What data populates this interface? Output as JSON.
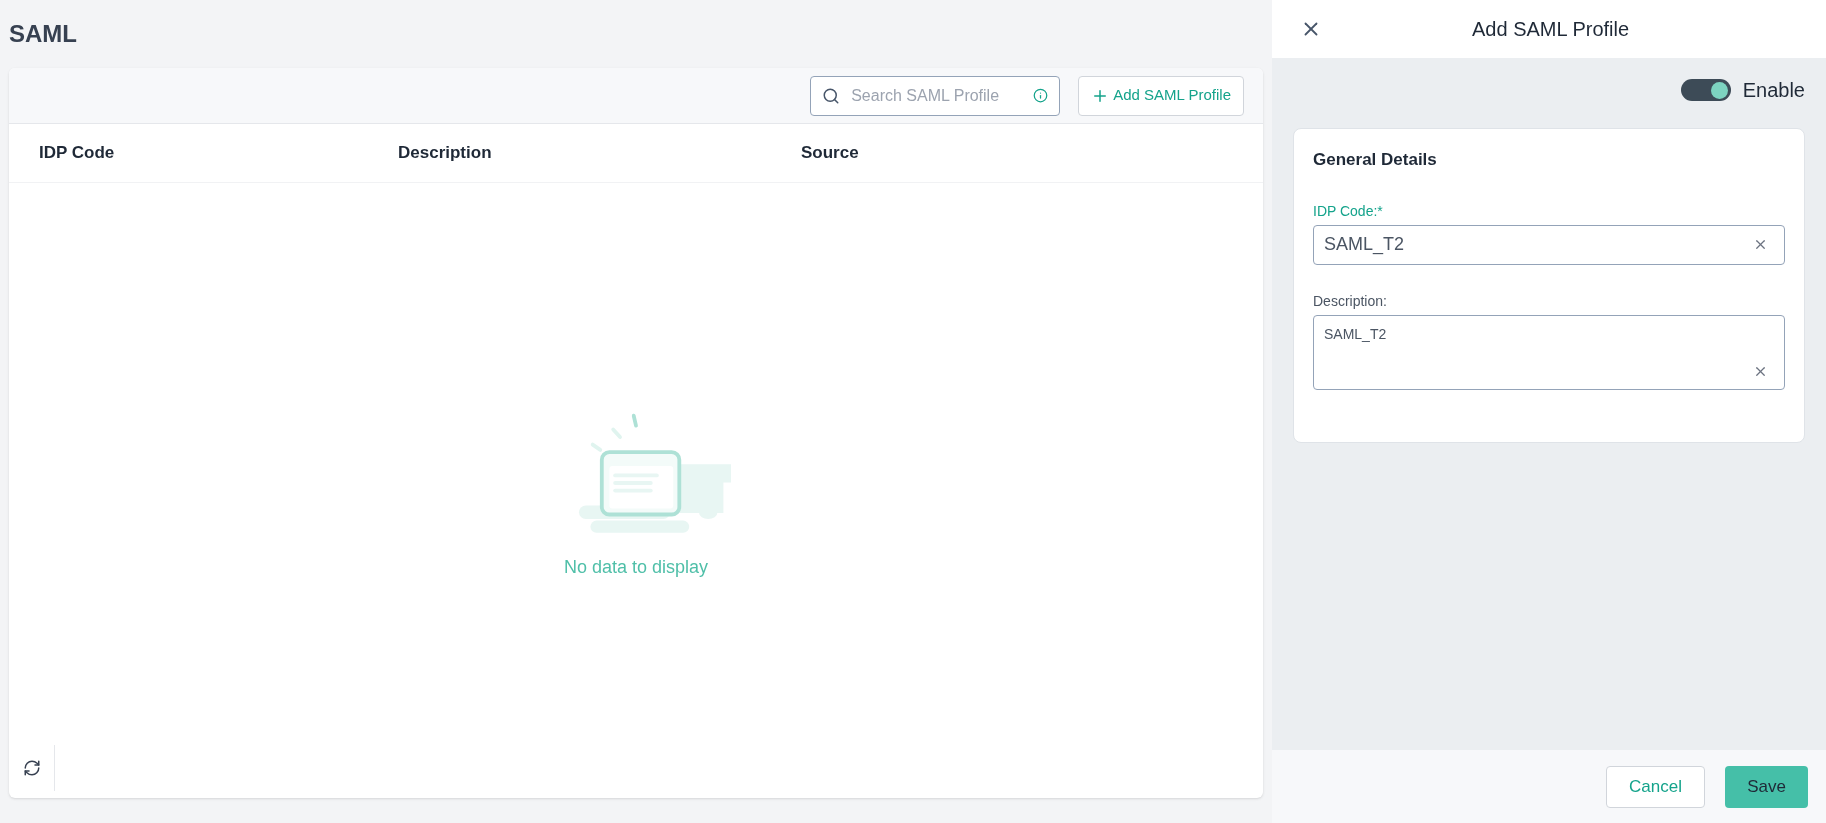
{
  "page": {
    "title": "SAML"
  },
  "toolbar": {
    "search": {
      "placeholder": "Search SAML Profile"
    },
    "add_button": "Add SAML Profile"
  },
  "table": {
    "columns": [
      "IDP Code",
      "Description",
      "Source"
    ],
    "empty_message": "No data to display"
  },
  "panel": {
    "title": "Add SAML Profile",
    "enable": {
      "label": "Enable",
      "on": true
    },
    "section_title": "General Details",
    "fields": [
      {
        "label": "IDP Code:*",
        "required": true,
        "value": "SAML_T2",
        "kind": "input"
      },
      {
        "label": "Description:",
        "required": false,
        "value": "SAML_T2",
        "kind": "textarea"
      }
    ],
    "buttons": {
      "cancel": "Cancel",
      "save": "Save"
    }
  }
}
